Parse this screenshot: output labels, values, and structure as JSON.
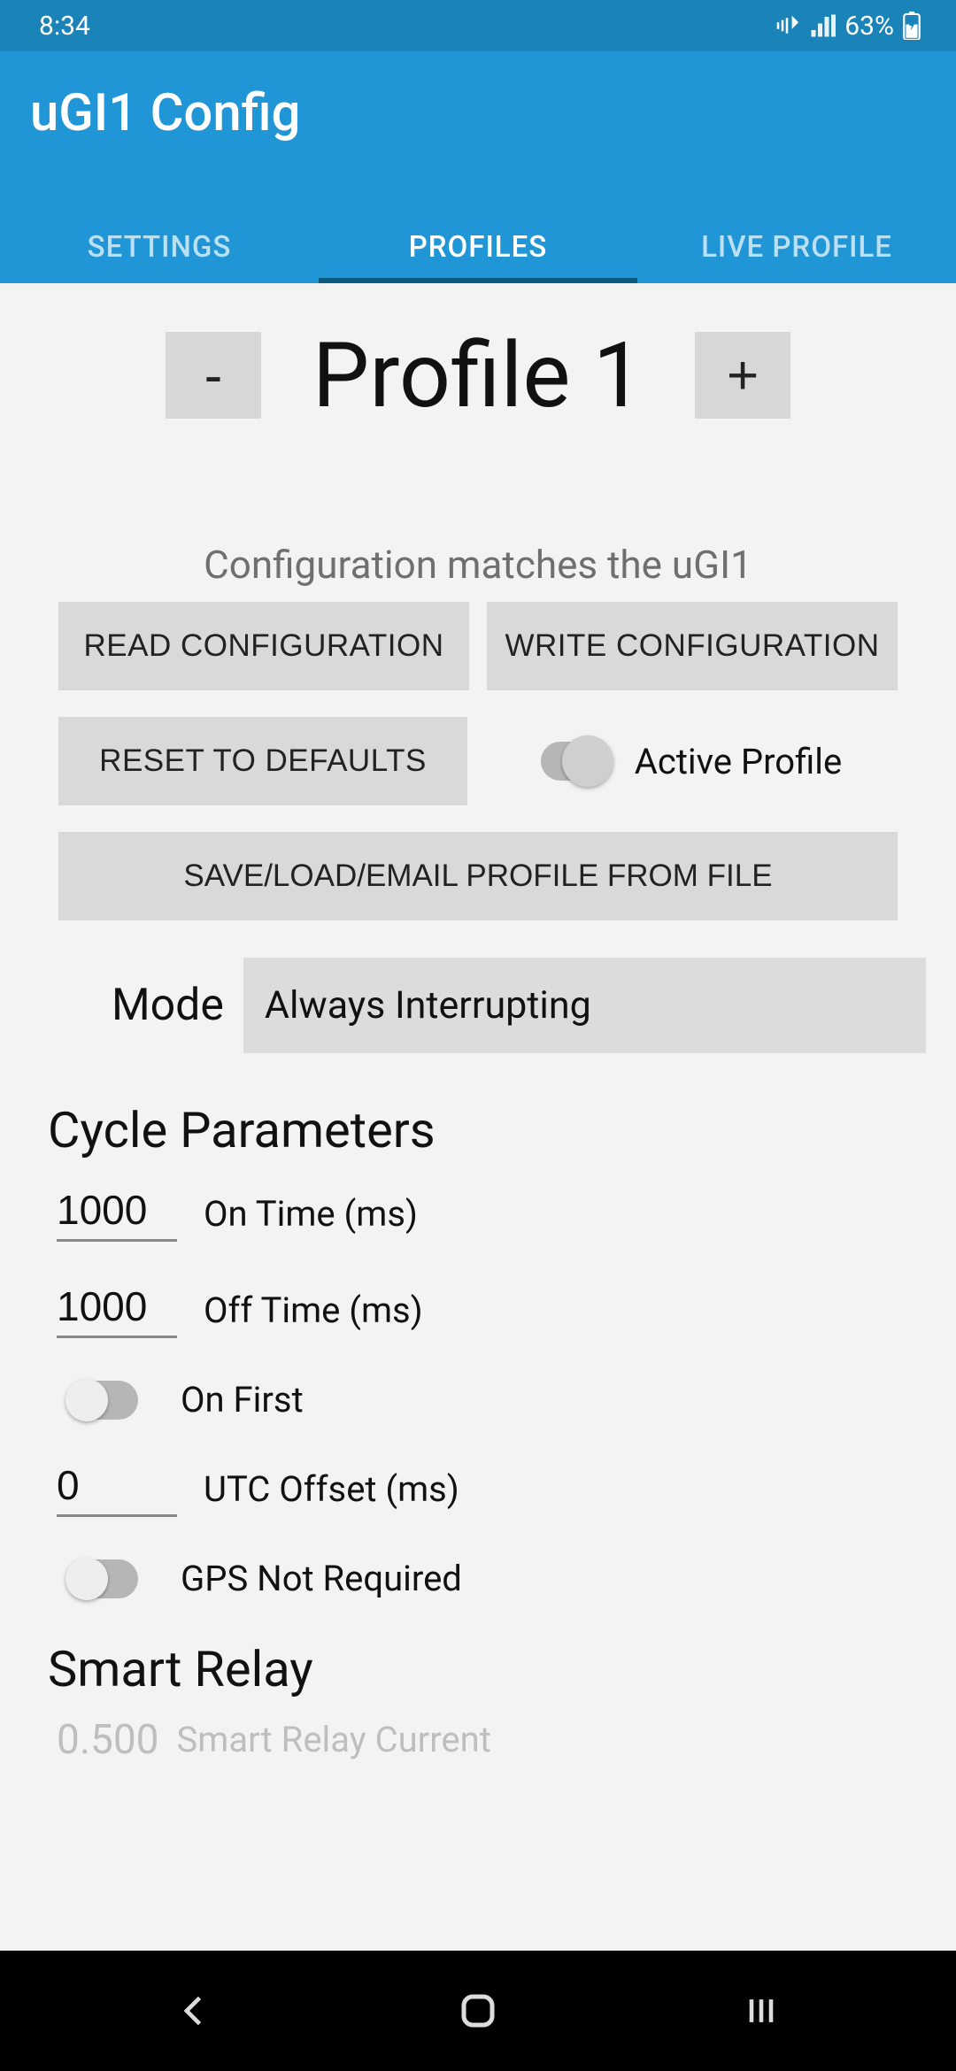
{
  "status": {
    "time": "8:34",
    "battery": "63%"
  },
  "app": {
    "title": "uGI1 Config"
  },
  "tabs": {
    "settings": "SETTINGS",
    "profiles": "PROFILES",
    "live": "LIVE PROFILE"
  },
  "profile": {
    "minus": "-",
    "plus": "+",
    "name": "Profile 1",
    "match_text": "Configuration matches the uGI1",
    "read": "READ CONFIGURATION",
    "write": "WRITE CONFIGURATION",
    "reset": "RESET TO DEFAULTS",
    "active_label": "Active Profile",
    "save_load": "SAVE/LOAD/EMAIL PROFILE FROM FILE"
  },
  "mode": {
    "label": "Mode",
    "value": "Always Interrupting"
  },
  "cycle": {
    "title": "Cycle Parameters",
    "on_time": "1000",
    "on_time_label": "On Time (ms)",
    "off_time": "1000",
    "off_time_label": "Off Time (ms)",
    "on_first_label": "On First",
    "utc_offset": "0",
    "utc_offset_label": "UTC Offset (ms)",
    "gps_label": "GPS Not Required"
  },
  "smart_relay": {
    "title": "Smart Relay",
    "current_val": "0.500",
    "current_label": "Smart Relay Current"
  }
}
